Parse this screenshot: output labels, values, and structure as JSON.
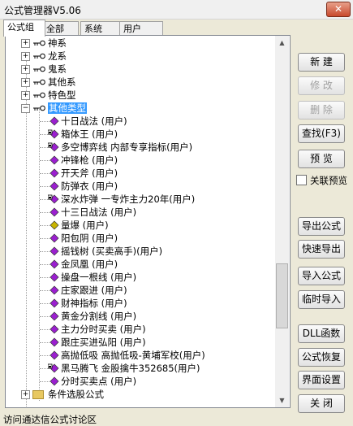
{
  "window": {
    "title": "公式管理器V5.06",
    "close_label": "✕"
  },
  "tabs": [
    {
      "label": "公式组"
    },
    {
      "label": "全部"
    },
    {
      "label": "系统"
    },
    {
      "label": "用户"
    }
  ],
  "tree": {
    "groups": [
      {
        "label": "神系"
      },
      {
        "label": "龙系"
      },
      {
        "label": "鬼系"
      },
      {
        "label": "其他系"
      },
      {
        "label": "特色型"
      },
      {
        "label": "其他类型",
        "selected": true
      }
    ],
    "items": [
      {
        "label": "十日战法   (用户)",
        "lock": false
      },
      {
        "label": "箱体王   (用户)",
        "lock": true
      },
      {
        "label": "多空博弈线   内部专享指标(用户)",
        "lock": true
      },
      {
        "label": "冲锋枪   (用户)",
        "lock": false
      },
      {
        "label": "开天斧   (用户)",
        "lock": false
      },
      {
        "label": "防弹衣   (用户)",
        "lock": false
      },
      {
        "label": "深水炸弹   一专炸主力20年(用户)",
        "lock": true
      },
      {
        "label": "十三日战法   (用户)",
        "lock": false
      },
      {
        "label": "量爆   (用户)",
        "lock": false,
        "yellow": true
      },
      {
        "label": "阳包阴   (用户)",
        "lock": false
      },
      {
        "label": "摇钱树   (买卖高手)(用户)",
        "lock": false
      },
      {
        "label": "金凤凰   (用户)",
        "lock": false
      },
      {
        "label": "操盘一根线   (用户)",
        "lock": false
      },
      {
        "label": "庄家跟进   (用户)",
        "lock": false
      },
      {
        "label": "财神指标   (用户)",
        "lock": false
      },
      {
        "label": "黄金分割线   (用户)",
        "lock": false
      },
      {
        "label": "主力分时买卖   (用户)",
        "lock": false
      },
      {
        "label": "跟庄买进弘阳   (用户)",
        "lock": false
      },
      {
        "label": "高抛低吸   高抛低吸-黄埔军校(用户)",
        "lock": false
      },
      {
        "label": "黑马腾飞   金股擒牛352685(用户)",
        "lock": true
      },
      {
        "label": "分时买卖点   (用户)",
        "lock": false
      }
    ],
    "partial_label": "条件选股公式"
  },
  "buttons": {
    "new": "新  建",
    "edit": "修  改",
    "delete": "删  除",
    "find": "查找(F3)",
    "preview": "预  览",
    "link_preview": "关联预览",
    "export": "导出公式",
    "quick_export": "快速导出",
    "import": "导入公式",
    "temp_import": "临时导入",
    "dll": "DLL函数",
    "restore": "公式恢复",
    "ui_settings": "界面设置",
    "close": "关  闭"
  },
  "status": {
    "text": "访问通达信公式讨论区"
  },
  "colors": {
    "selection": "#3399ff",
    "diamond": "#9b1fd0",
    "diamond_yellow": "#c8b400"
  }
}
